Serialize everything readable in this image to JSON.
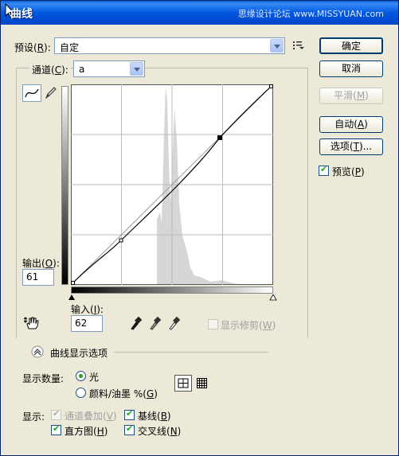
{
  "window": {
    "title": "曲线",
    "watermark": "思缘设计论坛 www.MISSYUAN.com"
  },
  "preset": {
    "label": "预设(",
    "key": "R",
    "tail": "):",
    "value": "自定"
  },
  "channel": {
    "label": "通道(",
    "key": "C",
    "tail": "):",
    "value": "a"
  },
  "buttons": {
    "ok": "确定",
    "cancel": "取消",
    "smooth_pre": "平滑(",
    "smooth_key": "M",
    "smooth_tail": ")",
    "auto_pre": "自动(",
    "auto_key": "A",
    "auto_tail": ")",
    "options_pre": "选项(",
    "options_key": "T",
    "options_tail": ")..."
  },
  "preview": {
    "pre": "预览(",
    "key": "P",
    "tail": ")",
    "checked": true
  },
  "output": {
    "pre": "输出(",
    "key": "O",
    "tail": "):",
    "value": "61"
  },
  "input": {
    "pre": "输入(",
    "key": "I",
    "tail": "):",
    "value": "62"
  },
  "show_clipping": {
    "pre": "显示修剪(",
    "key": "W",
    "tail": ")",
    "checked": false
  },
  "curve_options": {
    "label": "曲线显示选项"
  },
  "show_amount": {
    "label": "显示数量:",
    "light": "光",
    "pigment_pre": "颜料/油墨 %(",
    "pigment_key": "G",
    "pigment_tail": ")",
    "selected": "light"
  },
  "show": {
    "label": "显示:",
    "channel_overlay_pre": "通道叠加(",
    "channel_overlay_key": "V",
    "channel_overlay_tail": ")",
    "baseline_pre": "基线(",
    "baseline_key": "B",
    "baseline_tail": ")",
    "histogram_pre": "直方图(",
    "histogram_key": "H",
    "histogram_tail": ")",
    "intersection_pre": "交叉线(",
    "intersection_key": "N",
    "intersection_tail": ")"
  },
  "curve": {
    "points": [
      [
        0,
        0
      ],
      [
        62,
        61
      ],
      [
        191,
        193
      ],
      [
        255,
        255
      ]
    ]
  },
  "colors": {
    "accent": "#0058e0",
    "check": "#21a121"
  }
}
